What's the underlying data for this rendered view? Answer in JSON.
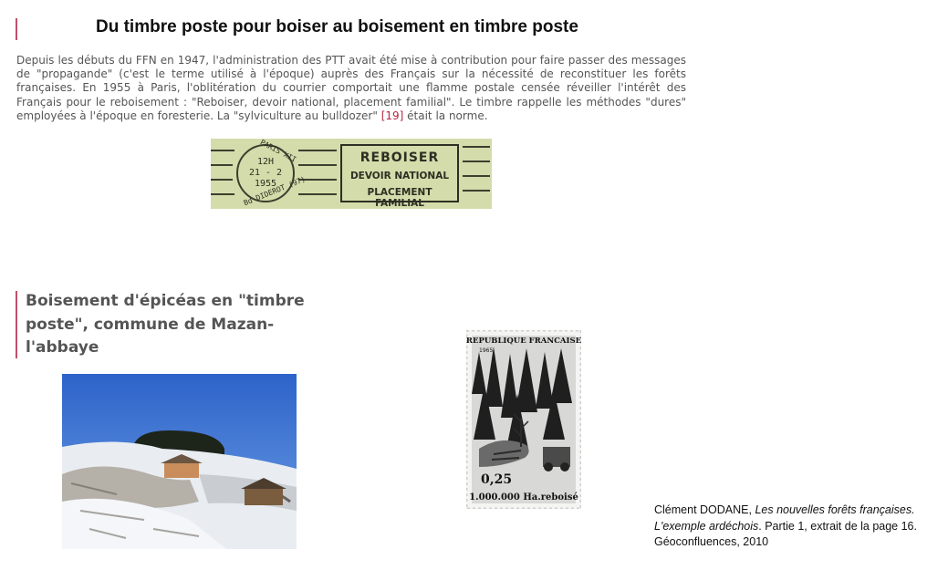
{
  "section1": {
    "title": "Du timbre poste pour boiser au boisement en timbre poste",
    "intro_text": "Depuis les débuts du FFN en 1947, l'administration des PTT avait été mise à contribution pour faire passer des messages de \"propagande\" (c'est le terme utilisé à l'époque) auprès des Français sur la nécessité de reconstituer les forêts françaises. En 1955 à Paris, l'oblitération du courrier comportait une flamme postale censée réveiller l'intérêt des Français pour le reboisement : \"Reboiser, devoir national, placement familial\". Le timbre rappelle les méthodes \"dures\" employées à l'époque en foresterie. La \"sylviculture au bulldozer\"",
    "ref_link": "[19]",
    "intro_end": " était la norme."
  },
  "postmark": {
    "city": "PARIS XII",
    "time": "12H",
    "date": "21 - 2",
    "year": "1955",
    "street": "Bd DIDEROT (97)",
    "flame_line1": "REBOISER",
    "flame_line2": "DEVOIR NATIONAL",
    "flame_line3": "PLACEMENT FAMILIAL",
    "ink_color": "#2c2f22",
    "paper_color": "#d4dcab"
  },
  "section2": {
    "title": "Boisement d'épicéas en \"timbre poste\", commune de Mazan-l'abbaye"
  },
  "stamp": {
    "country": "REPUBLIQUE FRANCAISE",
    "year": "1965",
    "value": "0,25",
    "caption": "1.000.000 Ha.reboisé"
  },
  "caption": {
    "author": "Clément DODANE, ",
    "book_title": "Les nouvelles forêts françaises. L'exemple ardéchois",
    "details": ". Partie 1, extrait de la page 16.",
    "publisher": "Géoconfluences, 2010"
  },
  "colors": {
    "accent_bar": "#c0506a",
    "link": "#b7263f",
    "body_text": "#555555"
  }
}
